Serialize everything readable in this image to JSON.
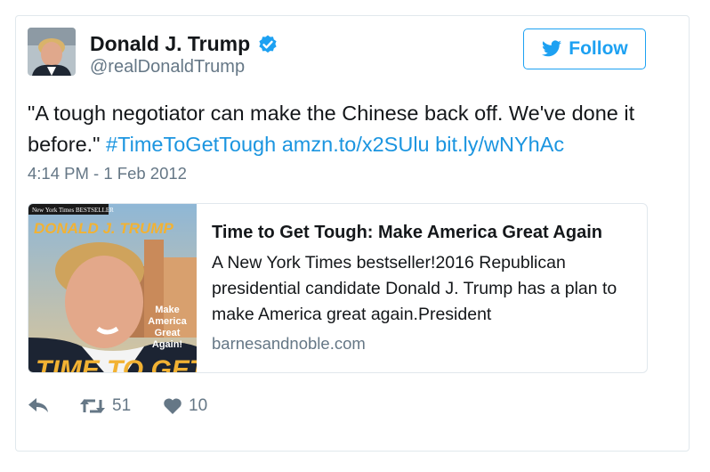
{
  "user": {
    "name": "Donald J. Trump",
    "handle": "@realDonaldTrump",
    "verified": true
  },
  "follow": {
    "label": "Follow"
  },
  "tweet": {
    "text": "\"A tough negotiator can make the Chinese back off. We've done it before.\"",
    "hashtag": "#TimeToGetTough",
    "link1": "amzn.to/x2SUlu",
    "link2": "bit.ly/wNYhAc",
    "timestamp": "4:14 PM - 1 Feb 2012"
  },
  "link_card": {
    "title": "Time to Get Tough: Make America Great Again",
    "description": "A New York Times bestseller!2016 Republican presidential candidate Donald J. Trump has a plan to make America great again.President",
    "domain": "barnesandnoble.com",
    "cover": {
      "banner": "New York Times BESTSELLER",
      "author": "DONALD J. TRUMP",
      "subtitle_lines": [
        "Make",
        "America",
        "Great",
        "Again!"
      ],
      "title": "TIME TO GET"
    }
  },
  "stats": {
    "retweets": "51",
    "likes": "10"
  },
  "colors": {
    "accent": "#1da1f2",
    "link": "#1b95e0",
    "muted": "#657786",
    "border": "#e1e8ed"
  },
  "icons": [
    "verified-icon",
    "twitter-bird-icon",
    "reply-icon",
    "retweet-icon",
    "heart-icon"
  ]
}
